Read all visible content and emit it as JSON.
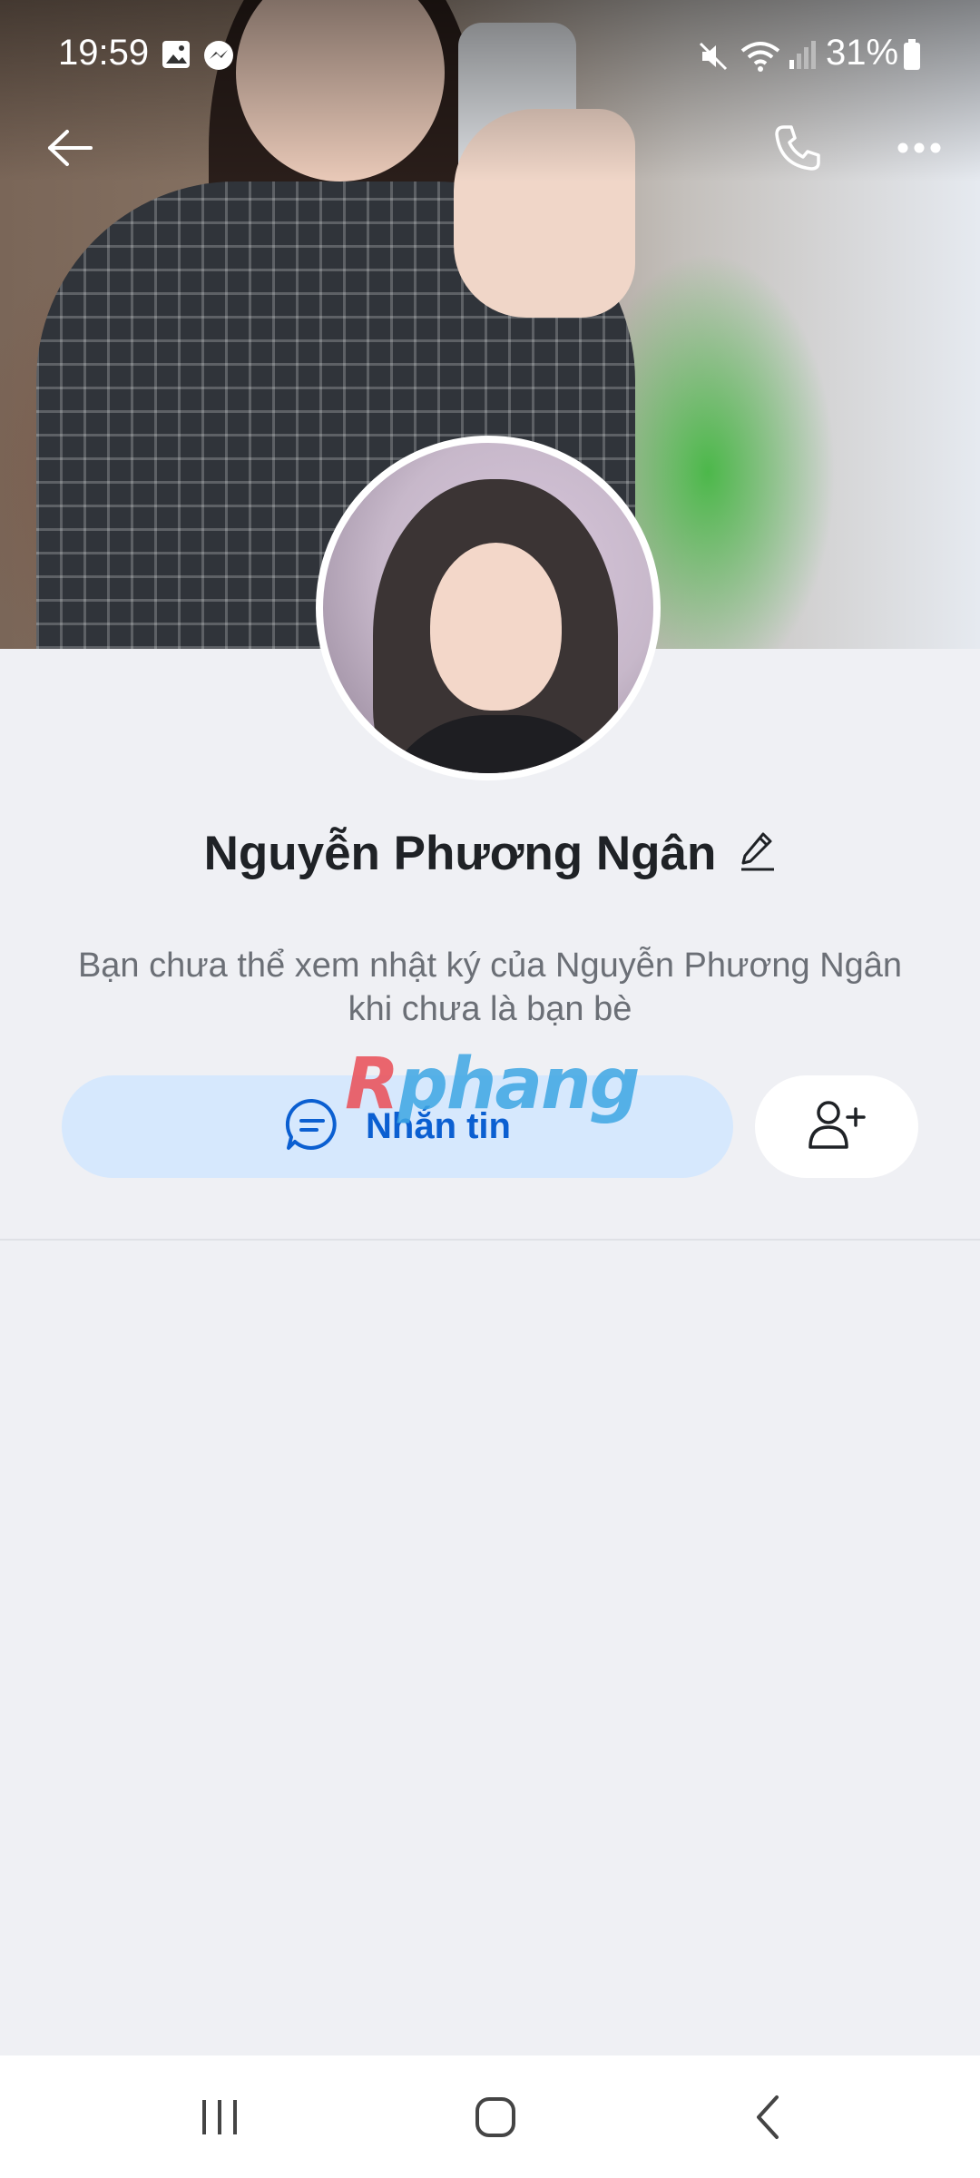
{
  "status_bar": {
    "time": "19:59",
    "battery": "31%",
    "left_icons": [
      "gallery-icon",
      "messenger-icon"
    ],
    "right_icons": [
      "mute-icon",
      "wifi-icon",
      "signal-icon",
      "battery-icon"
    ]
  },
  "header": {
    "back_icon": "arrow-left-icon",
    "call_icon": "phone-icon",
    "more_icon": "more-horizontal-icon"
  },
  "profile": {
    "name": "Nguyễn Phương Ngân",
    "edit_icon": "pencil-icon",
    "info_line1": "Bạn chưa thể xem nhật ký của Nguyễn Phương Ngân",
    "info_line2": "khi chưa là bạn bè"
  },
  "actions": {
    "message_label": "Nhắn tin",
    "message_icon": "chat-bubble-icon",
    "add_friend_icon": "add-user-icon"
  },
  "watermark": {
    "first": "R",
    "rest": "phang"
  },
  "system_nav": {
    "recents_icon": "recents-icon",
    "home_icon": "home-icon",
    "back_icon": "back-chevron-icon"
  },
  "colors": {
    "background": "#eff0f4",
    "message_button_bg": "#d6e8fd",
    "message_button_text": "#0b5fd1",
    "info_text": "#6b6f76"
  }
}
